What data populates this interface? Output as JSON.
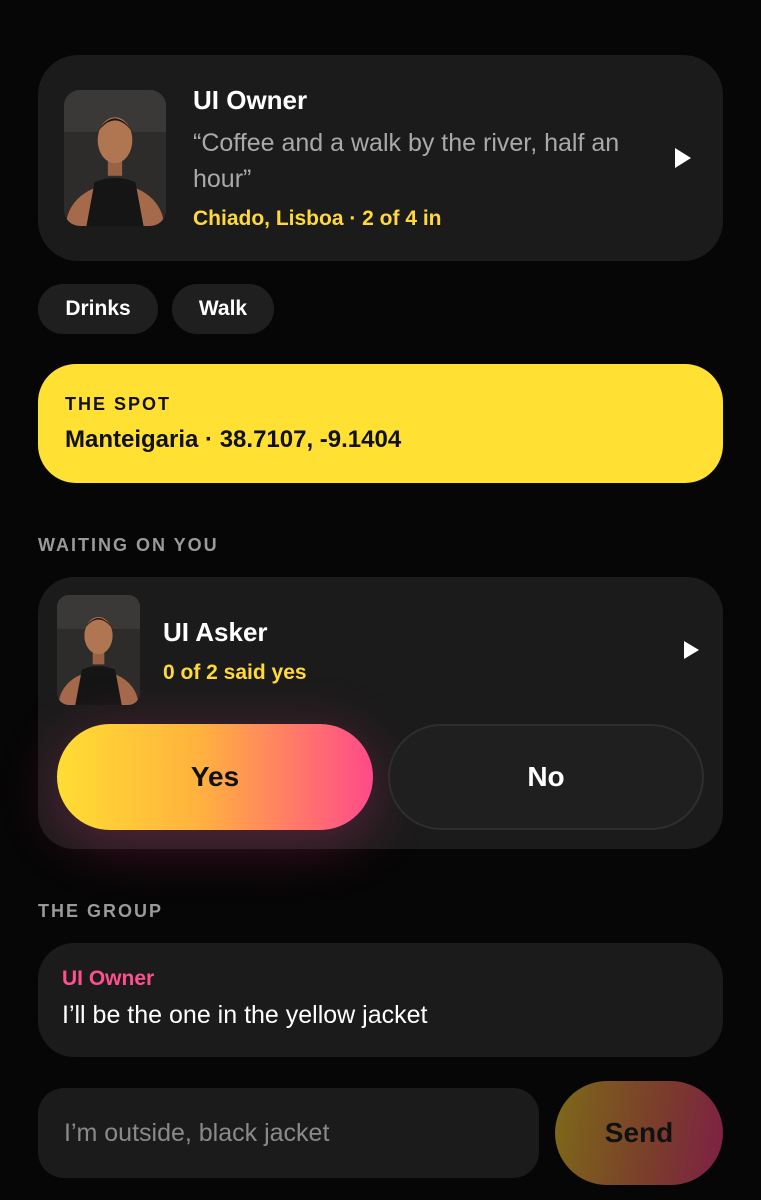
{
  "owner": {
    "name": "UI Owner",
    "quote": "“Coffee and a walk by the river, half an hour”",
    "meta": "Chiado, Lisboa · 2 of 4 in"
  },
  "tags": [
    "Drinks",
    "Walk"
  ],
  "spot": {
    "label": "THE SPOT",
    "value": "Manteigaria · 38.7107, -9.1404"
  },
  "waiting": {
    "section_label": "WAITING ON YOU",
    "asker_name": "UI Asker",
    "status": "0 of 2 said yes",
    "yes_label": "Yes",
    "no_label": "No"
  },
  "group": {
    "section_label": "THE GROUP",
    "messages": [
      {
        "author": "UI Owner",
        "text": "I’ll be the one in the yellow jacket"
      }
    ]
  },
  "compose": {
    "placeholder": "I’m outside, black jacket",
    "send_label": "Send"
  },
  "colors": {
    "background": "#060606",
    "card": "#1b1b1b",
    "accent_yellow": "#ffe033",
    "accent_pink": "#ff4f8f"
  },
  "icons": {
    "play": "play-icon",
    "avatar": "avatar-photo"
  }
}
